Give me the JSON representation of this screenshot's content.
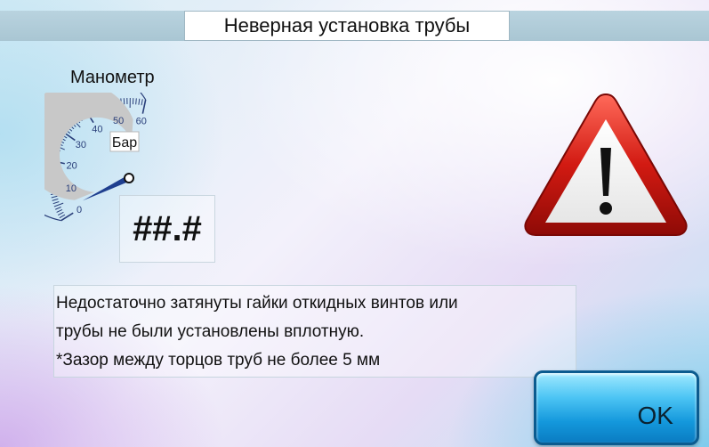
{
  "dialog": {
    "title": "Неверная установка трубы"
  },
  "gauge": {
    "label": "Манометр",
    "unit": "Бар",
    "tick_labels": [
      "0",
      "10",
      "20",
      "30",
      "40",
      "50",
      "60"
    ],
    "value_display": "##.#"
  },
  "message": {
    "lines": [
      "Недостаточно затянуты гайки откидных винтов или",
      "трубы не были установлены вплотную.",
      "*Зазор между торцов труб не более 5 мм"
    ]
  },
  "buttons": {
    "ok_label": "OK"
  },
  "icons": {
    "warning": "warning-triangle-icon"
  },
  "colors": {
    "gauge_tick": "#2a3f7a",
    "gauge_band": "#c8c8c8",
    "needle": "#1f3f8f",
    "warning_red": "#c81414",
    "ok_button": "#1498dc"
  }
}
